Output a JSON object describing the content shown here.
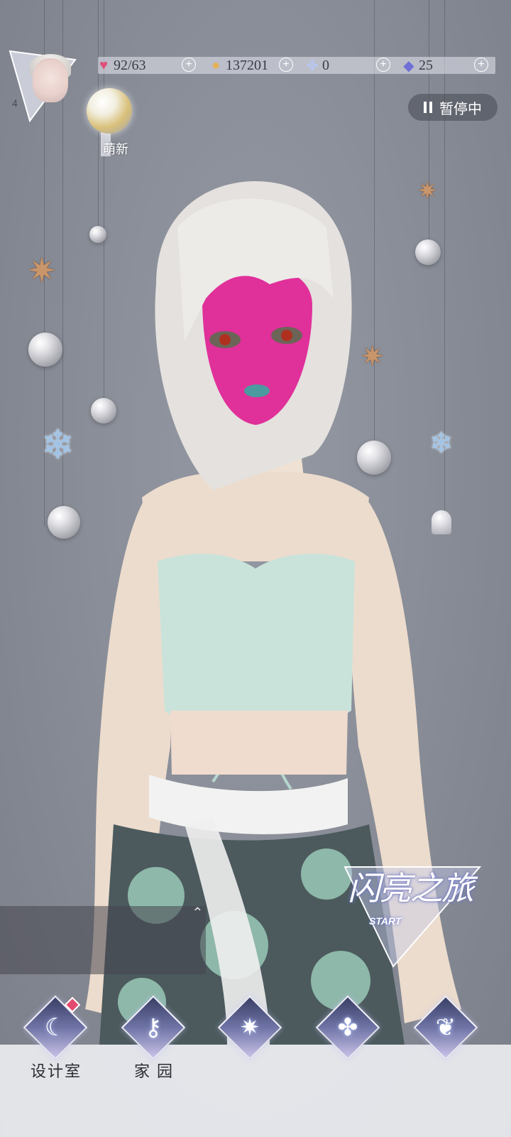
{
  "player": {
    "level": "4",
    "avatar_icon": "player-avatar-portrait",
    "badge_label": "萌新"
  },
  "resources": {
    "stamina": {
      "value": "92/63",
      "icon": "heart-gem-icon",
      "color": "#e0507a"
    },
    "gold": {
      "value": "137201",
      "icon": "gold-coin-icon",
      "color": "#e3b25a"
    },
    "crystal": {
      "value": "0",
      "icon": "crystal-flower-icon",
      "color": "#b9c6f0"
    },
    "diamond": {
      "value": "25",
      "icon": "diamond-icon",
      "color": "#6f6fd6"
    }
  },
  "status": {
    "pause_label": "暂停中"
  },
  "start_event": {
    "title": "闪亮之旅",
    "subtitle": "START"
  },
  "bottom_nav": [
    {
      "label": "设计室",
      "icon": "design-room-moon-icon",
      "badge": true
    },
    {
      "label": "家 园",
      "icon": "home-key-icon",
      "badge": false
    },
    {
      "label": "",
      "icon": "crystal-star-icon",
      "badge": false
    },
    {
      "label": "",
      "icon": "clover-icon",
      "badge": false
    },
    {
      "label": "",
      "icon": "butterfly-icon",
      "badge": false
    }
  ],
  "colors": {
    "background": "#8a8e98",
    "bottom_bar": "#f0f1f5",
    "nav_label": "#2b2b33"
  }
}
